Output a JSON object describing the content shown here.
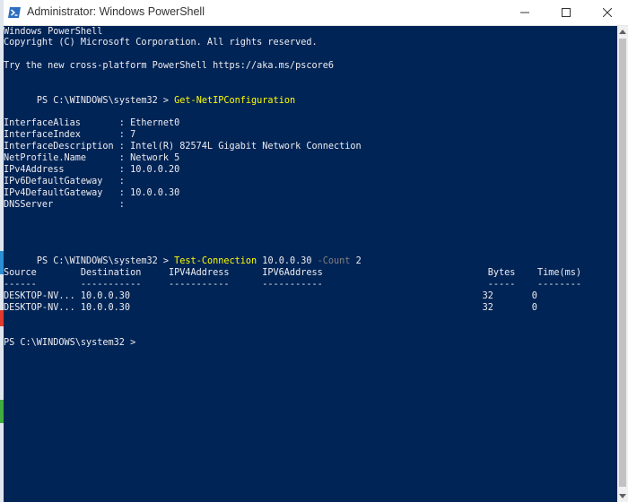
{
  "window": {
    "title": "Administrator: Windows PowerShell",
    "icon": "powershell-icon",
    "controls": [
      "minimize-icon",
      "maximize-icon",
      "close-icon"
    ]
  },
  "colors": {
    "console_bg": "#012456",
    "console_fg": "#eeedf0",
    "command": "#ffff00",
    "parameter": "#808080"
  },
  "console": {
    "header_line1": "Windows PowerShell",
    "header_line2": "Copyright (C) Microsoft Corporation. All rights reserved.",
    "header_line3": "Try the new cross-platform PowerShell https://aka.ms/pscore6",
    "prompt": "PS C:\\WINDOWS\\system32 > ",
    "cmd1": "Get-NetIPConfiguration",
    "ipconfig": [
      "InterfaceAlias       : Ethernet0",
      "InterfaceIndex       : 7",
      "InterfaceDescription : Intel(R) 82574L Gigabit Network Connection",
      "NetProfile.Name      : Network 5",
      "IPv4Address          : 10.0.0.20",
      "IPv6DefaultGateway   :",
      "IPv4DefaultGateway   : 10.0.0.30",
      "DNSServer            :"
    ],
    "cmd2": "Test-Connection",
    "cmd2_arg": " 10.0.0.30 ",
    "cmd2_param": "-Count",
    "cmd2_value": " 2",
    "table_header": "Source        Destination     IPV4Address      IPV6Address                              Bytes    Time(ms)",
    "table_rule": "------        -----------     -----------      -----------                              -----    --------",
    "table_rows": [
      "DESKTOP-NV... 10.0.0.30                                                                32       0",
      "DESKTOP-NV... 10.0.0.30                                                                32       0"
    ],
    "final_prompt": "PS C:\\WINDOWS\\system32 >"
  }
}
